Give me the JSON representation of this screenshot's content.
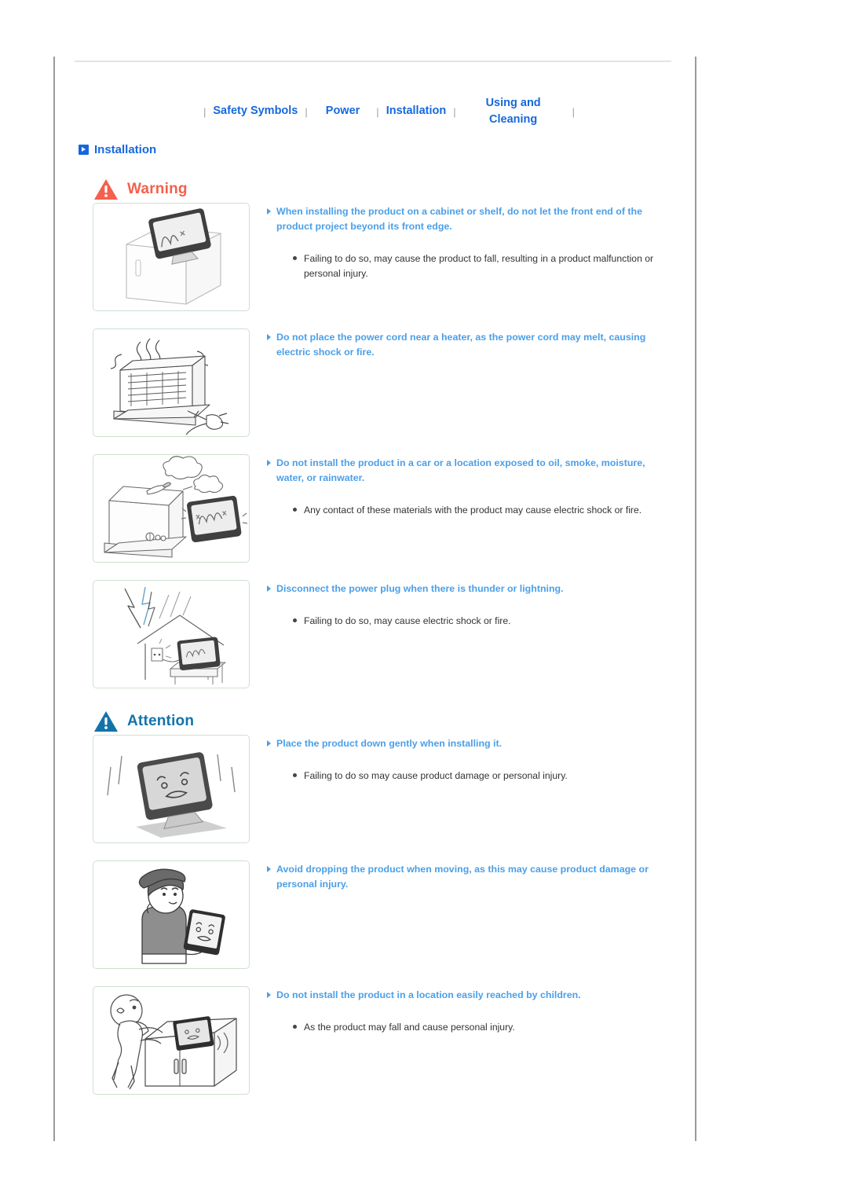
{
  "topnav": {
    "separator": "|",
    "links": [
      {
        "label": "Safety Symbols"
      },
      {
        "label": "Power"
      },
      {
        "label": "Installation"
      },
      {
        "label": "Using and Cleaning"
      }
    ],
    "link_color": "#1668dc"
  },
  "section": {
    "title": "Installation",
    "icon": "arrow-square-icon",
    "color": "#1668dc"
  },
  "banners": {
    "warning": {
      "label": "Warning",
      "icon": "warning-triangle-icon",
      "color": "#f4604c"
    },
    "attention": {
      "label": "Attention",
      "icon": "attention-triangle-icon",
      "color": "#1273aa"
    }
  },
  "items": [
    {
      "illustration": "monitor-on-cabinet-edge-illustration",
      "heading": "When installing the product on a cabinet or shelf, do not let the front end of the product project beyond its front edge.",
      "detail": "Failing to do so, may cause the product to fall, resulting in a product malfunction or personal injury."
    },
    {
      "illustration": "heater-with-power-cord-illustration",
      "heading": "Do not place the power cord near a heater, as the power cord may melt, causing electric shock or fire.",
      "detail": ""
    },
    {
      "illustration": "smoke-moisture-machine-illustration",
      "heading": "Do not install the product in a car or a location exposed to oil, smoke, moisture, water, or rainwater.",
      "detail": "Any contact of these materials with the product may cause electric shock or fire."
    },
    {
      "illustration": "lightning-over-house-illustration",
      "heading": "Disconnect the power plug when there is thunder or lightning.",
      "detail": "Failing to do so, may cause electric shock or fire."
    },
    {
      "illustration": "monitor-dropped-illustration",
      "heading": "Place the product down gently when installing it.",
      "detail": "Failing to do so may cause product damage or personal injury."
    },
    {
      "illustration": "person-carrying-monitor-illustration",
      "heading": "Avoid dropping the product when moving, as this may cause product damage or personal injury.",
      "detail": ""
    },
    {
      "illustration": "child-reaching-monitor-illustration",
      "heading": "Do not install the product in a location easily reached by children.",
      "detail": "As the product may fall and cause personal injury."
    }
  ]
}
